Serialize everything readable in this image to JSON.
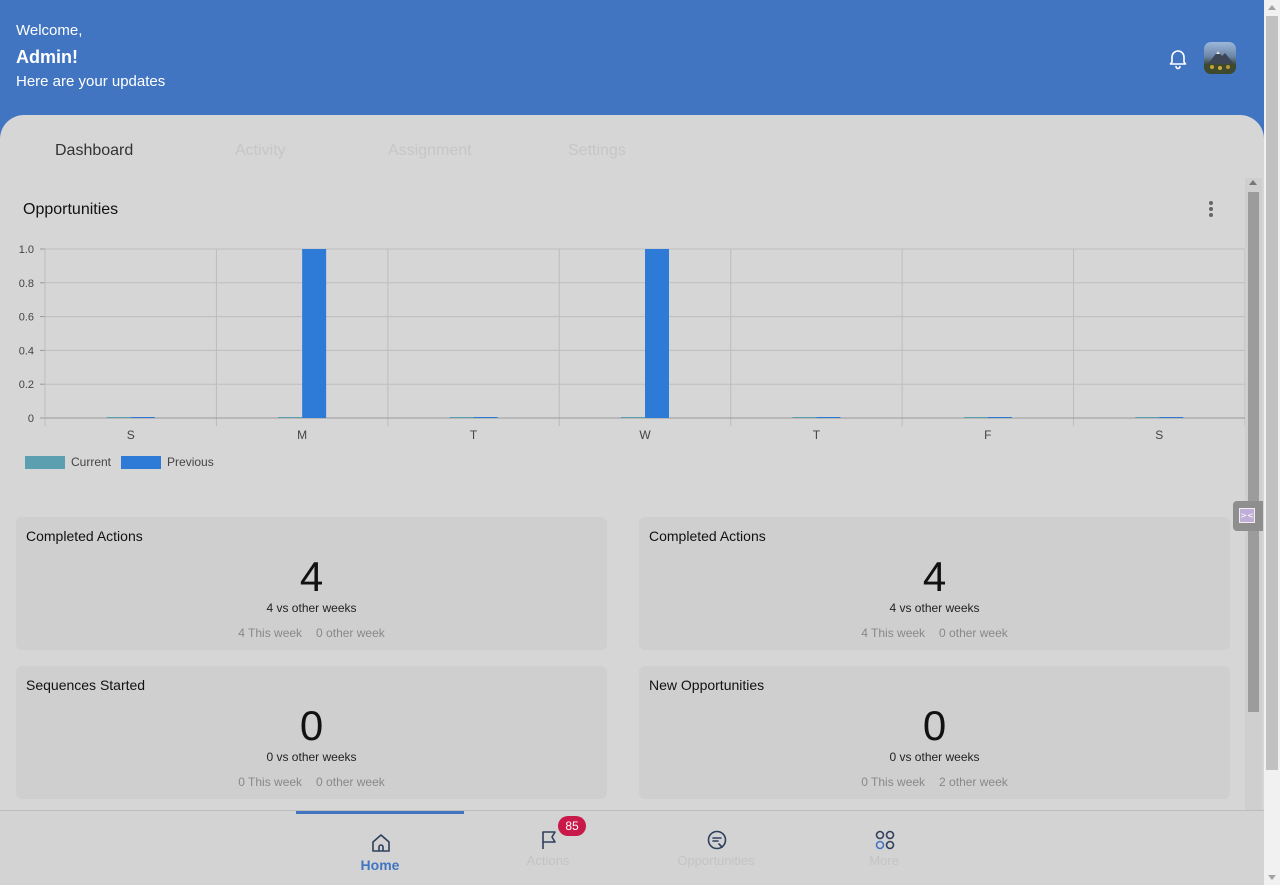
{
  "header": {
    "welcome": "Welcome,",
    "user": "Admin!",
    "subtitle": "Here are your updates",
    "bell_icon": "bell-icon",
    "avatar_icon": "avatar-image"
  },
  "tabs": [
    {
      "label": "Dashboard",
      "active": true
    },
    {
      "label": "Activity",
      "active": false
    },
    {
      "label": "Assignment",
      "active": false
    },
    {
      "label": "Settings",
      "active": false
    }
  ],
  "opportunities": {
    "title": "Opportunities",
    "menu_icon": "more-vertical-icon"
  },
  "chart_data": {
    "type": "bar",
    "title": "",
    "xlabel": "",
    "ylabel": "",
    "categories": [
      "S",
      "M",
      "T",
      "W",
      "T",
      "F",
      "S"
    ],
    "series": [
      {
        "name": "Current",
        "color": "#5b9fb0",
        "values": [
          0,
          0,
          0,
          0,
          0,
          0,
          0
        ]
      },
      {
        "name": "Previous",
        "color": "#2d7bd6",
        "values": [
          0,
          1,
          0,
          1,
          0,
          0,
          0
        ]
      }
    ],
    "ylim": [
      0,
      1.0
    ],
    "yticks": [
      "0",
      "0.2",
      "0.4",
      "0.6",
      "0.8",
      "1.0"
    ],
    "grid": true,
    "legend_position": "bottom-left"
  },
  "cards": [
    {
      "title": "Completed Actions",
      "value": "4",
      "summary": "4 vs other weeks",
      "this_week": "4 This week",
      "other_week": "0 other week"
    },
    {
      "title": "Completed Actions",
      "value": "4",
      "summary": "4 vs other weeks",
      "this_week": "4 This week",
      "other_week": "0 other week"
    },
    {
      "title": "Sequences Started",
      "value": "0",
      "summary": "0 vs other weeks",
      "this_week": "0 This week",
      "other_week": "0 other week"
    },
    {
      "title": "New Opportunities",
      "value": "0",
      "summary": "0 vs other weeks",
      "this_week": "0 This week",
      "other_week": "2 other week"
    }
  ],
  "nav": [
    {
      "label": "Home",
      "icon": "home-icon",
      "active": true
    },
    {
      "label": "Actions",
      "icon": "flag-icon",
      "active": false,
      "badge": "85"
    },
    {
      "label": "Opportunities",
      "icon": "opportunities-icon",
      "active": false
    },
    {
      "label": "More",
      "icon": "grid-icon",
      "active": false
    }
  ],
  "colors": {
    "header": "#4175c2",
    "accent": "#4175c2",
    "badge": "#c9184a"
  }
}
